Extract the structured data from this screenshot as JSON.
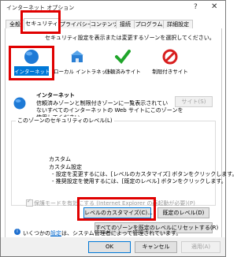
{
  "window": {
    "title": "インターネット オプション"
  },
  "tabs": [
    "全般",
    "セキュリティ",
    "プライバシー",
    "コンテンツ",
    "接続",
    "プログラム",
    "詳細設定"
  ],
  "instruction": "セキュリティ設定を表示または変更するゾーンを選択してください。",
  "zones": [
    {
      "label": "インターネット",
      "icon": "globe-icon"
    },
    {
      "label": "ローカル イントラネット",
      "icon": "intranet-icon"
    },
    {
      "label": "信頼済みサイト",
      "icon": "checkmark-icon"
    },
    {
      "label": "制限付きサイト",
      "icon": "restricted-icon"
    }
  ],
  "zone_info": {
    "title": "インターネット",
    "desc_lines": [
      "信頼済みゾーンと制限付きゾーンに一覧表示されてい",
      "ないすべてのインターネットの Web サイトにこのゾーンを",
      "使用してください。"
    ],
    "sites_button": "サイト(S)"
  },
  "security_level": {
    "group_title": "このゾーンのセキュリティのレベル(L)",
    "level_title": "カスタム",
    "level_subtitle": "カスタム設定",
    "bullets": [
      "- 設定を変更するには、[レベルのカスタマイズ] ボタンをクリックします。",
      "- 推奨設定を使用するには、[既定のレベル] ボタンをクリックします。"
    ],
    "protected_mode": "保護モードを有効にする (Internet Explorer の再起動が必要)(P)",
    "custom_button": "レベルのカスタマイズ(C)...",
    "default_button": "既定のレベル(D)",
    "reset_all_button": "すべてのゾーンを既定のレベルにリセットする(R)"
  },
  "admin_note": {
    "prefix": "いくつかの",
    "link": "設定",
    "suffix": "は、システム管理者によって管理されています。"
  },
  "footer": {
    "ok": "OK",
    "cancel": "キャンセル",
    "apply": "適用(A)"
  },
  "colors": {
    "highlight": "#e00000",
    "selected_zone": "#0078d7"
  }
}
